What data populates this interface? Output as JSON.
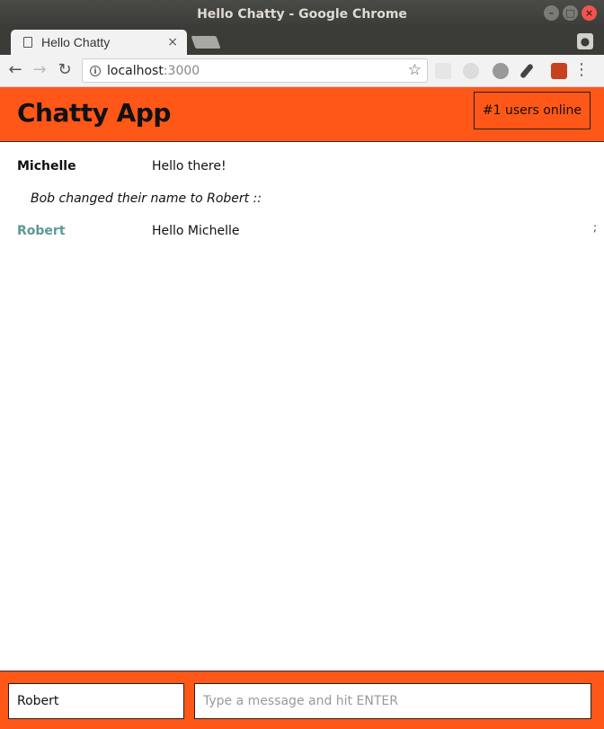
{
  "window": {
    "title": "Hello Chatty - Google Chrome",
    "controls": {
      "minimize": "–",
      "maximize": "□",
      "close": "×"
    }
  },
  "browser": {
    "tab_title": "Hello Chatty",
    "tab_close": "×",
    "url_host": "localhost",
    "url_port": ":3000",
    "back": "←",
    "forward": "→",
    "reload": "↻",
    "star": "☆",
    "menu": "⋮",
    "profile": "●"
  },
  "app": {
    "brand": "Chatty App",
    "users_online": "#1 users online",
    "accent_color": "#ff5718"
  },
  "messages": [
    {
      "username": "Michelle",
      "content": "Hello there!",
      "username_color": "#111111"
    },
    {
      "system": "Bob changed their name to Robert ::"
    },
    {
      "username": "Robert",
      "content": "Hello Michelle",
      "username_color": "#5b9a95"
    }
  ],
  "scroll_mark": ";",
  "chatbar": {
    "username_value": "Robert",
    "message_placeholder": "Type a message and hit ENTER"
  }
}
